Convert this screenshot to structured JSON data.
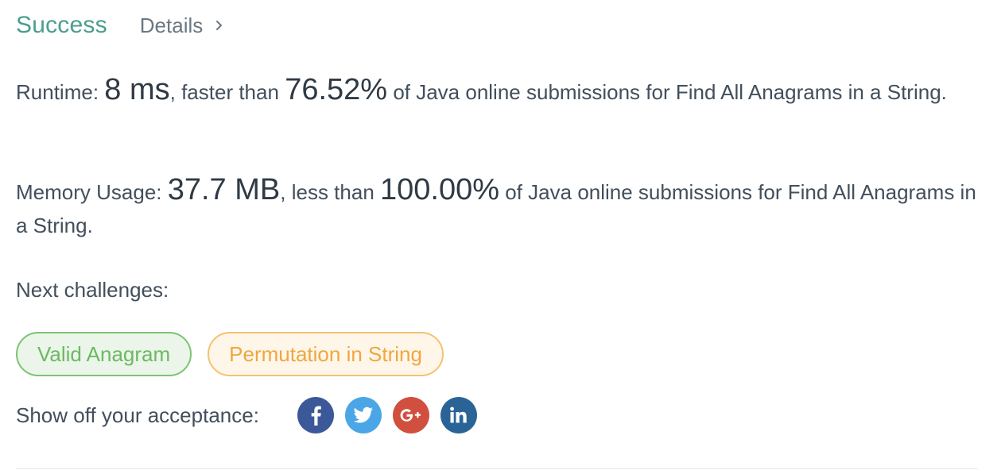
{
  "header": {
    "status": "Success",
    "details_label": "Details"
  },
  "runtime": {
    "label": "Runtime:",
    "value": "8 ms",
    "comparison": ", faster than",
    "percent": "76.52%",
    "suffix": "of Java online submissions for Find All Anagrams in a String."
  },
  "memory": {
    "label": "Memory Usage:",
    "value": "37.7 MB",
    "comparison": ", less than",
    "percent": "100.00%",
    "suffix": "of Java online submissions for Find All Anagrams in a String."
  },
  "next_challenges": {
    "label": "Next challenges:",
    "items": [
      {
        "label": "Valid Anagram",
        "difficulty_color": "#6cb963"
      },
      {
        "label": "Permutation in String",
        "difficulty_color": "#efa73e"
      }
    ]
  },
  "share": {
    "label": "Show off your acceptance:",
    "networks": [
      {
        "icon": "facebook-icon",
        "color": "#3b5998"
      },
      {
        "icon": "twitter-icon",
        "color": "#4aa6e6"
      },
      {
        "icon": "google-plus-icon",
        "color": "#d14f3e"
      },
      {
        "icon": "linkedin-icon",
        "color": "#2a6496"
      }
    ]
  },
  "colors": {
    "success": "#4a9e8c",
    "text": "#424f5c"
  }
}
